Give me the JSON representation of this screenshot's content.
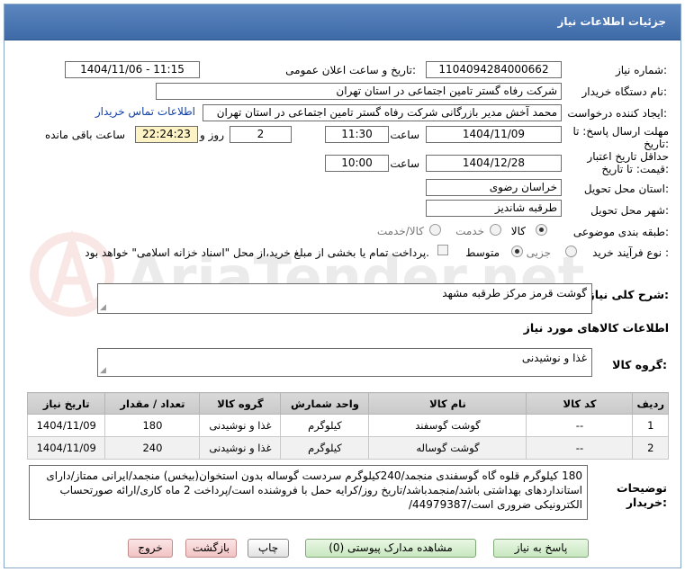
{
  "header": {
    "title": "جزئیات اطلاعات نیاز"
  },
  "fields": {
    "need_number_label": "شماره نیاز:",
    "need_number": "1104094284000662",
    "announce_label": "تاریخ و ساعت اعلان عمومی:",
    "announce_value": "1404/11/06 - 11:15",
    "buyer_org_label": "نام دستگاه خریدار:",
    "buyer_org": "شرکت رفاه گستر تامین اجتماعی در استان تهران",
    "requester_label": "ایجاد کننده درخواست:",
    "requester": "محمد آخش مدیر بازرگانی شرکت رفاه گستر تامین اجتماعی در استان تهران",
    "buyer_contact_link": "اطلاعات تماس خریدار",
    "deadline_label_1": "مهلت ارسال پاسخ: تا",
    "deadline_label_2": "تاریخ:",
    "deadline_date": "1404/11/09",
    "time_label": "ساعت",
    "deadline_time": "11:30",
    "days_value": "2",
    "days_and_label": "روز و",
    "countdown": "22:24:23",
    "remaining_label": "ساعت باقی مانده",
    "validity_label_1": "حداقل تاریخ اعتبار",
    "validity_label_2": "قیمت: تا تاریخ:",
    "validity_date": "1404/12/28",
    "validity_time_label": "ساعت",
    "validity_time": "10:00",
    "province_label": "استان محل تحویل:",
    "province": "خراسان رضوی",
    "city_label": "شهر محل تحویل:",
    "city": "طرقبه شاندیز",
    "category_label": "طبقه بندی موضوعی:",
    "category_options": [
      "کالا",
      "خدمت",
      "کالا/خدمت"
    ],
    "category_selected": "کالا",
    "process_label": "نوع فرآیند خرید :",
    "process_options": [
      "جزیی",
      "متوسط"
    ],
    "process_selected": "متوسط",
    "treasury_note": "پرداخت تمام یا بخشی از مبلغ خرید،از محل \"اسناد خزانه اسلامی\" خواهد بود."
  },
  "description": {
    "label": "شرح کلی نیاز:",
    "value": "گوشت قرمز مرکز طرقبه مشهد"
  },
  "goods_info": {
    "title": "اطلاعات کالاهای مورد نیاز"
  },
  "goods_group": {
    "label": "گروه کالا:",
    "value": "غذا و نوشیدنی"
  },
  "table": {
    "headers": [
      "ردیف",
      "کد کالا",
      "نام کالا",
      "واحد شمارش",
      "گروه کالا",
      "تعداد / مقدار",
      "تاریخ نیاز"
    ],
    "rows": [
      [
        "1",
        "--",
        "گوشت گوسفند",
        "کیلوگرم",
        "غذا و نوشیدنی",
        "180",
        "1404/11/09"
      ],
      [
        "2",
        "--",
        "گوشت گوساله",
        "کیلوگرم",
        "غذا و نوشیدنی",
        "240",
        "1404/11/09"
      ]
    ]
  },
  "buyer_notes": {
    "label_1": "توضیحات",
    "label_2": "خریدار:",
    "value": "180 کیلوگرم قلوه گاه گوسفندی منجمد/240کیلوگرم سردست گوساله بدون استخوان(بیخس) منجمد/ایرانی ممتاز/دارای استانداردهای بهداشتی باشد/منجمدباشد/تاریخ روز/کرایه حمل با فروشنده است/پرداخت 2 ماه کاری/ارائه صورتحساب الکترونیکی ضروری است/44979387/"
  },
  "buttons": {
    "respond": "پاسخ به نیاز",
    "view_docs": "مشاهده مدارک پیوستی (0)",
    "print": "چاپ",
    "back": "بازگشت",
    "exit": "خروج"
  },
  "watermark": {
    "text": "AriaTender.net"
  },
  "colors": {
    "header": "#4a76b2",
    "link": "#0f3fa7",
    "countdown_bg": "#fdf3c4"
  }
}
